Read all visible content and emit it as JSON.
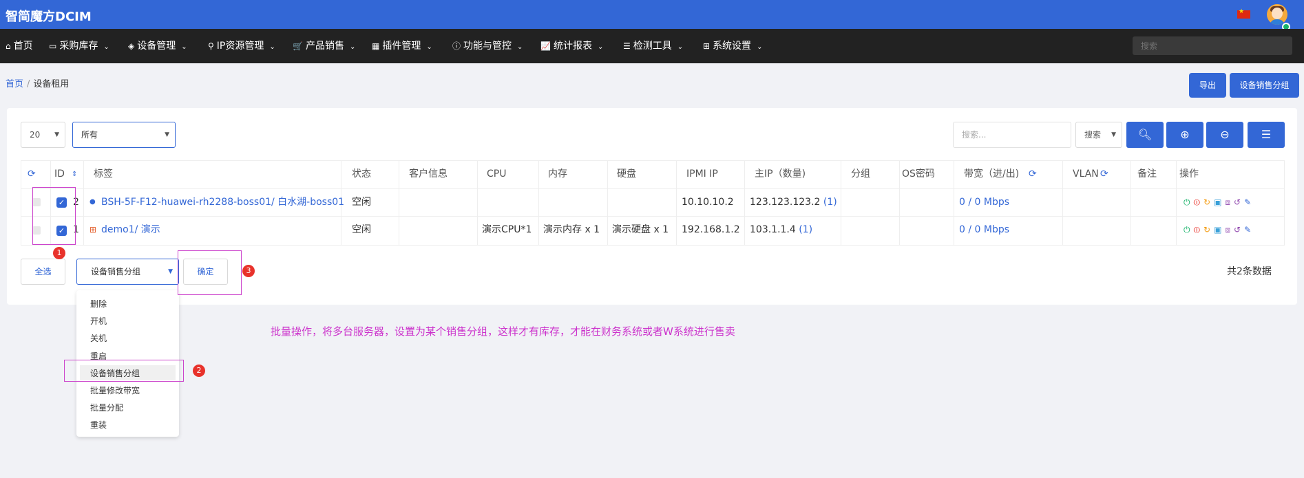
{
  "app": {
    "title": "智简魔方DCIM"
  },
  "colors": {
    "primary": "#3367d6",
    "nav_bg": "#222222",
    "annotation": "#cc44cc",
    "marker": "#e8322b"
  },
  "nav": {
    "items": [
      {
        "label": "首页",
        "icon": "home-icon"
      },
      {
        "label": "采购库存",
        "icon": "inbox-icon"
      },
      {
        "label": "设备管理",
        "icon": "cube-icon"
      },
      {
        "label": "IP资源管理",
        "icon": "map-marker-icon"
      },
      {
        "label": "产品销售",
        "icon": "cart-icon"
      },
      {
        "label": "插件管理",
        "icon": "grid-icon"
      },
      {
        "label": "功能与管控",
        "icon": "info-icon"
      },
      {
        "label": "统计报表",
        "icon": "chart-line-icon"
      },
      {
        "label": "检测工具",
        "icon": "list-icon"
      },
      {
        "label": "系统设置",
        "icon": "windows-icon"
      }
    ],
    "search_placeholder": "搜索"
  },
  "breadcrumb": {
    "home": "首页",
    "current": "设备租用"
  },
  "header_buttons": {
    "export": "导出",
    "sales_group": "设备销售分组"
  },
  "toolbar": {
    "page_size": "20",
    "filter": "所有",
    "search_placeholder": "搜索...",
    "search_type": "搜索"
  },
  "table": {
    "columns": [
      "ID",
      "标签",
      "状态",
      "客户信息",
      "CPU",
      "内存",
      "硬盘",
      "IPMI IP",
      "主IP（数量)",
      "分组",
      "OS密码",
      "带宽（进/出)",
      "VLAN",
      "备注",
      "操作"
    ],
    "rows": [
      {
        "id": "2",
        "label": "BSH-5F-F12-huawei-rh2288-boss01/ 白水湖-boss01",
        "status": "空闲",
        "customer": "",
        "cpu": "",
        "memory": "",
        "disk": "",
        "ipmi": "10.10.10.2",
        "main_ip": "123.123.123.2",
        "ip_count": "(1)",
        "group": "",
        "os_password": "",
        "bandwidth": "0 / 0 Mbps",
        "vlan": "",
        "remark": ""
      },
      {
        "id": "1",
        "label": "demo1/ 演示",
        "status": "空闲",
        "customer": "",
        "cpu": "演示CPU*1",
        "memory": "演示内存 x 1",
        "disk": "演示硬盘 x 1",
        "ipmi": "192.168.1.2",
        "main_ip": "103.1.1.4",
        "ip_count": "(1)",
        "group": "",
        "os_password": "",
        "bandwidth": "0 / 0 Mbps",
        "vlan": "",
        "remark": ""
      }
    ]
  },
  "bulk": {
    "select_all": "全选",
    "action": "设备销售分组",
    "confirm": "确定",
    "total": "共2条数据",
    "options": [
      "删除",
      "开机",
      "关机",
      "重启",
      "设备销售分组",
      "批量修改带宽",
      "批量分配",
      "重装"
    ]
  },
  "annotations": {
    "markers": [
      "1",
      "2",
      "3"
    ],
    "note": "批量操作，将多台服务器，设置为某个销售分组，这样才有库存，才能在财务系统或者W系统进行售卖"
  }
}
